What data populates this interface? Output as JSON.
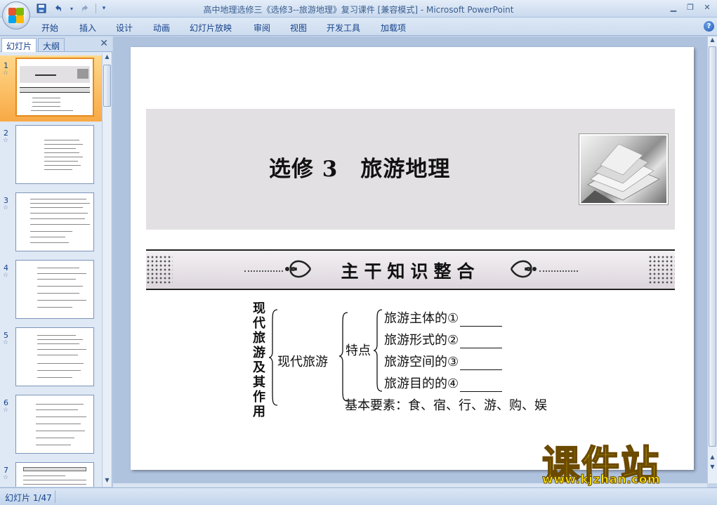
{
  "window": {
    "title": "高中地理选修三《选修3--旅游地理》复习课件 [兼容模式] - Microsoft PowerPoint"
  },
  "ribbon": {
    "tabs": [
      "开始",
      "插入",
      "设计",
      "动画",
      "幻灯片放映",
      "审阅",
      "视图",
      "开发工具",
      "加载项"
    ]
  },
  "pane": {
    "tab_slides": "幻灯片",
    "tab_outline": "大纲",
    "close": "✕",
    "slides": [
      {
        "num": "1",
        "star": "☆"
      },
      {
        "num": "2",
        "star": "☆"
      },
      {
        "num": "3",
        "star": "☆"
      },
      {
        "num": "4",
        "star": "☆"
      },
      {
        "num": "5",
        "star": "☆"
      },
      {
        "num": "6",
        "star": "☆"
      },
      {
        "num": "7",
        "star": "☆"
      }
    ],
    "selected_index": 0
  },
  "slide": {
    "title": "选修 3　旅游地理",
    "banner": "主干知识整合",
    "root_vertical": "现代旅游及其作用",
    "node_modern": "现代旅游",
    "node_features": "特点",
    "features": [
      "旅游主体的①",
      "旅游形式的②",
      "旅游空间的③",
      "旅游目的的④"
    ],
    "basic_elements": "基本要素：食、宿、行、游、购、娱"
  },
  "watermark": {
    "brand": "课件站",
    "url": "www.kjzhan.com"
  },
  "status": {
    "slide_indicator": "幻灯片 1/47"
  },
  "colors": {
    "ribbon_text": "#15428b",
    "selected_thumb": "#f8a945",
    "watermark": "#ffea00"
  }
}
